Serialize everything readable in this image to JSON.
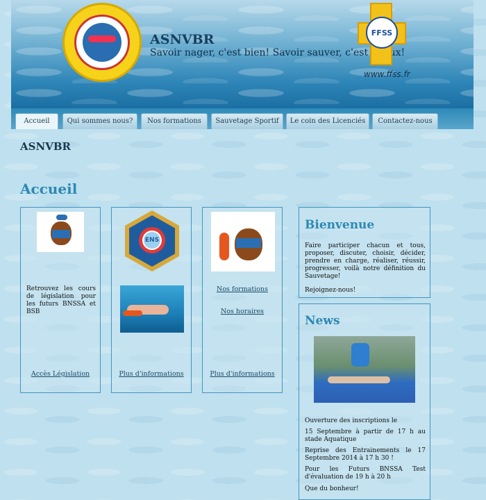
{
  "header": {
    "site_title": "ASNVBR",
    "slogan": "Savoir nager, c'est bien! Savoir sauver, c'est mieux!",
    "ffss_url": "www.ffss.fr",
    "ffss_logo_text": "FFSS"
  },
  "nav": {
    "tabs": [
      {
        "label": "Accueil",
        "active": true
      },
      {
        "label": "Qui sommes nous?",
        "active": false
      },
      {
        "label": "Nos formations",
        "active": false
      },
      {
        "label": "Sauvetage Sportif",
        "active": false
      },
      {
        "label": "Le coin des Licenciés",
        "active": false
      },
      {
        "label": "Contactez-nous",
        "active": false
      }
    ]
  },
  "main": {
    "breadcrumb_title": "ASNVBR",
    "page_title": "Accueil",
    "col1": {
      "text": "Retrouvez les cours de législation pour les futurs BNSSA et BSB",
      "link": "Accès Législation"
    },
    "col2": {
      "badge_text": "ENS",
      "link": "Plus d'informations"
    },
    "col3": {
      "link1": "Nos formations",
      "link2": "Nos horaires",
      "link3": "Plus d'informations"
    }
  },
  "sidebar": {
    "welcome": {
      "title": "Bienvenue",
      "text": "Faire participer chacun et tous, proposer, discuter, choisir, décider, prendre en charge, réaliser, réussir, progresser, voilà notre définition du Sauvetage!",
      "cta": "Rejoignez-nous!"
    },
    "news": {
      "title": "News",
      "items": [
        "Ouverture des inscriptions le",
        "15 Septembre à partir de 17 h au stade Aquatique",
        "Reprise des Entrainements le 17 Septembre 2014 à 17 h 30 !",
        "Pour les Futurs BNSSA Test d'évaluation de 19 h à 20 h",
        "Que du bonheur!"
      ]
    }
  },
  "colors": {
    "accent": "#2d88b3",
    "border": "#3f95c2",
    "background": "#bfe0ee"
  }
}
